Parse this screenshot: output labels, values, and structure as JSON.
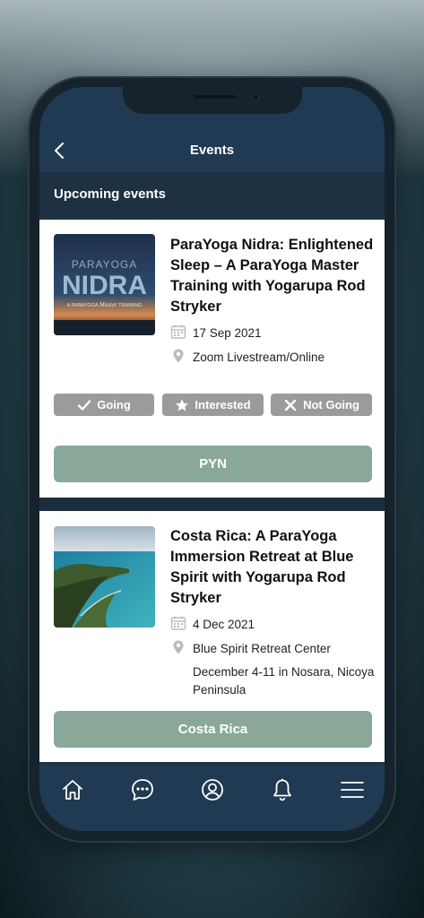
{
  "header": {
    "title": "Events",
    "back_icon": "chevron-left-icon"
  },
  "section": {
    "title": "Upcoming events"
  },
  "events": [
    {
      "title": "ParaYoga Nidra: Enlightened Sleep – A ParaYoga Master Training with Yogarupa Rod Stryker",
      "date": "17 Sep 2021",
      "location": "Zoom Livestream/Online",
      "image": {
        "line1": "PARAYOGA",
        "line2": "NIDRA",
        "line3_a": "A PARAYOGA",
        "line3_b": "Master",
        "line3_c": "TRAINING"
      },
      "rsvp": {
        "going": "Going",
        "interested": "Interested",
        "not_going": "Not Going"
      },
      "button": "PYN"
    },
    {
      "title": "Costa Rica: A ParaYoga Immersion Retreat at Blue Spirit with Yogarupa Rod Stryker",
      "date": "4 Dec 2021",
      "location": "Blue Spirit Retreat Center",
      "location_detail": "December 4-11 in Nosara, Nicoya Peninsula",
      "button": "Costa Rica"
    }
  ],
  "tabbar": {
    "items": [
      "home-icon",
      "chat-icon",
      "profile-icon",
      "bell-icon",
      "menu-icon"
    ]
  },
  "colors": {
    "navy": "#1f3a52",
    "sage_button": "#89a89a",
    "rsvp_gray": "#9b9b9b"
  }
}
